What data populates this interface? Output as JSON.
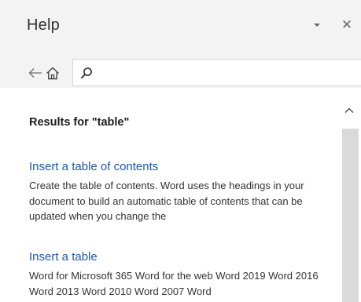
{
  "header": {
    "title": "Help",
    "dropdown_icon": "caret-down-icon",
    "close_label": "✕"
  },
  "nav": {
    "back_icon": "back-arrow-icon",
    "home_icon": "home-icon"
  },
  "search": {
    "icon": "search-icon",
    "value": "",
    "placeholder": ""
  },
  "results": {
    "heading": "Results for \"table\"",
    "items": [
      {
        "title": "Insert a table of contents",
        "snippet": "Create the table of contents. Word uses the headings in your document to build an automatic table of contents that can be updated when you change the"
      },
      {
        "title": "Insert a table",
        "snippet": "Word for Microsoft 365 Word for the web Word 2019 Word 2016 Word 2013 Word 2010 Word 2007 Word"
      }
    ]
  },
  "colors": {
    "link": "#1e56a8",
    "pane_background": "#f3f3f3",
    "content_background": "#ffffff",
    "scroll_thumb": "#dadada"
  }
}
